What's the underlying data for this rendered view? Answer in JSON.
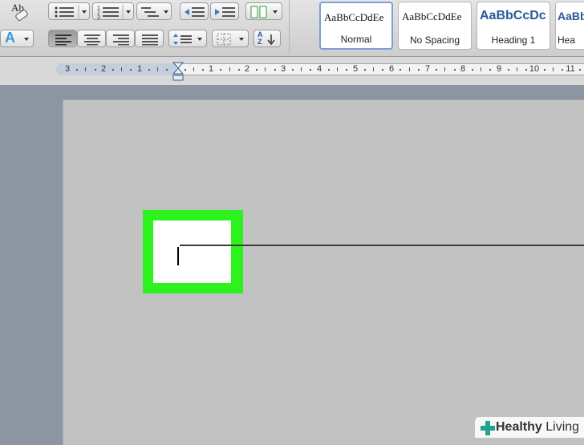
{
  "styles_gallery": {
    "items": [
      {
        "preview": "AaBbCcDdEe",
        "label": "Normal",
        "selected": true
      },
      {
        "preview": "AaBbCcDdEe",
        "label": "No Spacing",
        "selected": false
      },
      {
        "preview": "AaBbCcDc",
        "label": "Heading 1",
        "selected": false
      },
      {
        "preview": "AaBb",
        "label": "Hea",
        "selected": false
      }
    ]
  },
  "ruler": {
    "labels": [
      "3",
      "2",
      "1",
      "1",
      "2",
      "3",
      "4",
      "5",
      "6",
      "7",
      "8",
      "9",
      "10",
      "11"
    ]
  },
  "toolbar": {
    "change_case_glyph": "Ab",
    "text_effects_glyph": "A",
    "sort_glyph": "AZ"
  },
  "watermark": {
    "brand_bold": "Healthy",
    "brand_light": "Living"
  },
  "colors": {
    "highlight": "#2ef21d",
    "selected_style_border": "#7d9fd3",
    "heading_style_text": "#2b5797",
    "text_effects_blue": "#3b9bd6",
    "watermark_plus": "#25a18e"
  }
}
